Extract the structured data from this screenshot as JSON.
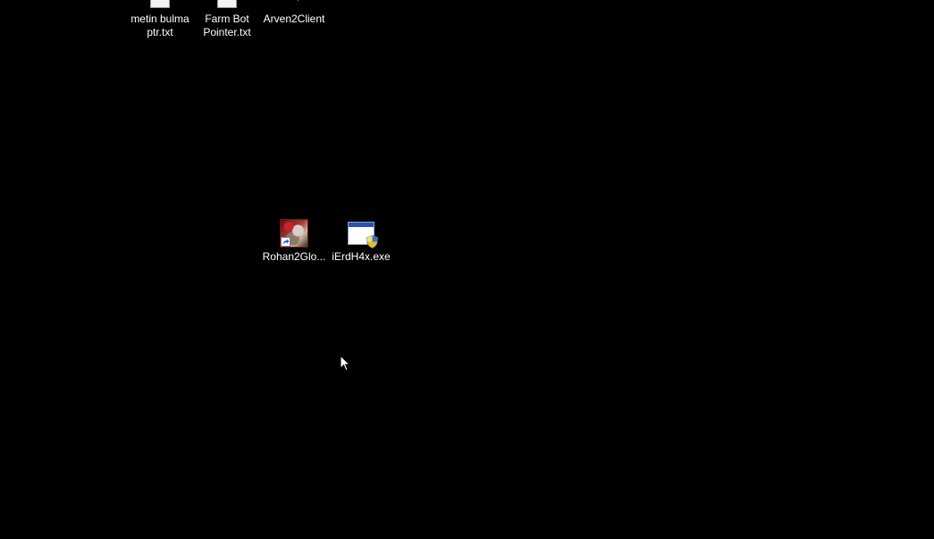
{
  "desktop": {
    "background_color": "#000000",
    "icons": [
      {
        "label": "metin bulma\nptr.txt",
        "icon": "text-file-icon"
      },
      {
        "label": "Farm Bot\nPointer.txt",
        "icon": "text-file-icon"
      },
      {
        "label": "Arven2Client",
        "icon": "game-client-icon"
      },
      {
        "label": "Rohan2Glo...",
        "icon": "game-shortcut-icon"
      },
      {
        "label": "iErdH4x.exe",
        "icon": "exe-shield-icon"
      }
    ]
  },
  "cursor": {
    "icon": "mouse-pointer-icon"
  }
}
